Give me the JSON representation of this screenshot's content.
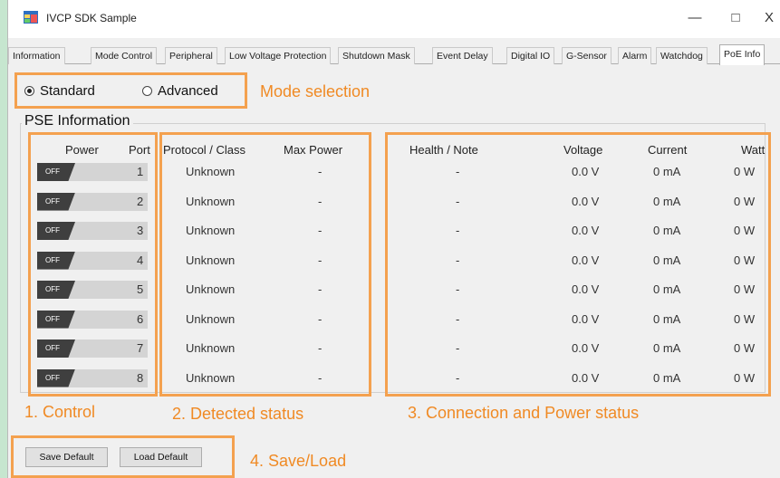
{
  "window": {
    "title": "IVCP SDK Sample",
    "minimize_glyph": "—",
    "maximize_glyph": "□",
    "close_glyph": "X"
  },
  "tabs": [
    {
      "label": "Information"
    },
    {
      "label": "Mode Control"
    },
    {
      "label": "Peripheral"
    },
    {
      "label": "Low Voltage Protection"
    },
    {
      "label": "Shutdown Mask"
    },
    {
      "label": "Event Delay"
    },
    {
      "label": "Digital IO"
    },
    {
      "label": "G-Sensor"
    },
    {
      "label": "Alarm"
    },
    {
      "label": "Watchdog"
    },
    {
      "label": "PoE Info",
      "active": true
    }
  ],
  "mode": {
    "standard_label": "Standard",
    "advanced_label": "Advanced",
    "selected": "Standard"
  },
  "pse": {
    "group_title": "PSE Information",
    "headers": {
      "power": "Power",
      "port": "Port",
      "protocol": "Protocol / Class",
      "max_power": "Max Power",
      "health": "Health / Note",
      "voltage": "Voltage",
      "current": "Current",
      "watt": "Watt"
    },
    "toggle_off_label": "OFF",
    "rows": [
      {
        "port": "1",
        "protocol": "Unknown",
        "max_power": "-",
        "health": "-",
        "voltage": "0.0 V",
        "current": "0 mA",
        "watt": "0 W"
      },
      {
        "port": "2",
        "protocol": "Unknown",
        "max_power": "-",
        "health": "-",
        "voltage": "0.0 V",
        "current": "0 mA",
        "watt": "0 W"
      },
      {
        "port": "3",
        "protocol": "Unknown",
        "max_power": "-",
        "health": "-",
        "voltage": "0.0 V",
        "current": "0 mA",
        "watt": "0 W"
      },
      {
        "port": "4",
        "protocol": "Unknown",
        "max_power": "-",
        "health": "-",
        "voltage": "0.0 V",
        "current": "0 mA",
        "watt": "0 W"
      },
      {
        "port": "5",
        "protocol": "Unknown",
        "max_power": "-",
        "health": "-",
        "voltage": "0.0 V",
        "current": "0 mA",
        "watt": "0 W"
      },
      {
        "port": "6",
        "protocol": "Unknown",
        "max_power": "-",
        "health": "-",
        "voltage": "0.0 V",
        "current": "0 mA",
        "watt": "0 W"
      },
      {
        "port": "7",
        "protocol": "Unknown",
        "max_power": "-",
        "health": "-",
        "voltage": "0.0 V",
        "current": "0 mA",
        "watt": "0 W"
      },
      {
        "port": "8",
        "protocol": "Unknown",
        "max_power": "-",
        "health": "-",
        "voltage": "0.0 V",
        "current": "0 mA",
        "watt": "0 W"
      }
    ]
  },
  "annotations": {
    "mode": "Mode selection",
    "control": "1.  Control",
    "detected": "2.  Detected status",
    "connection": "3.  Connection and Power status",
    "saveload": "4.  Save/Load",
    "color": "#f08a24"
  },
  "buttons": {
    "save_default": "Save Default",
    "load_default": "Load Default"
  },
  "icons": {
    "app": "app-window-icon"
  }
}
